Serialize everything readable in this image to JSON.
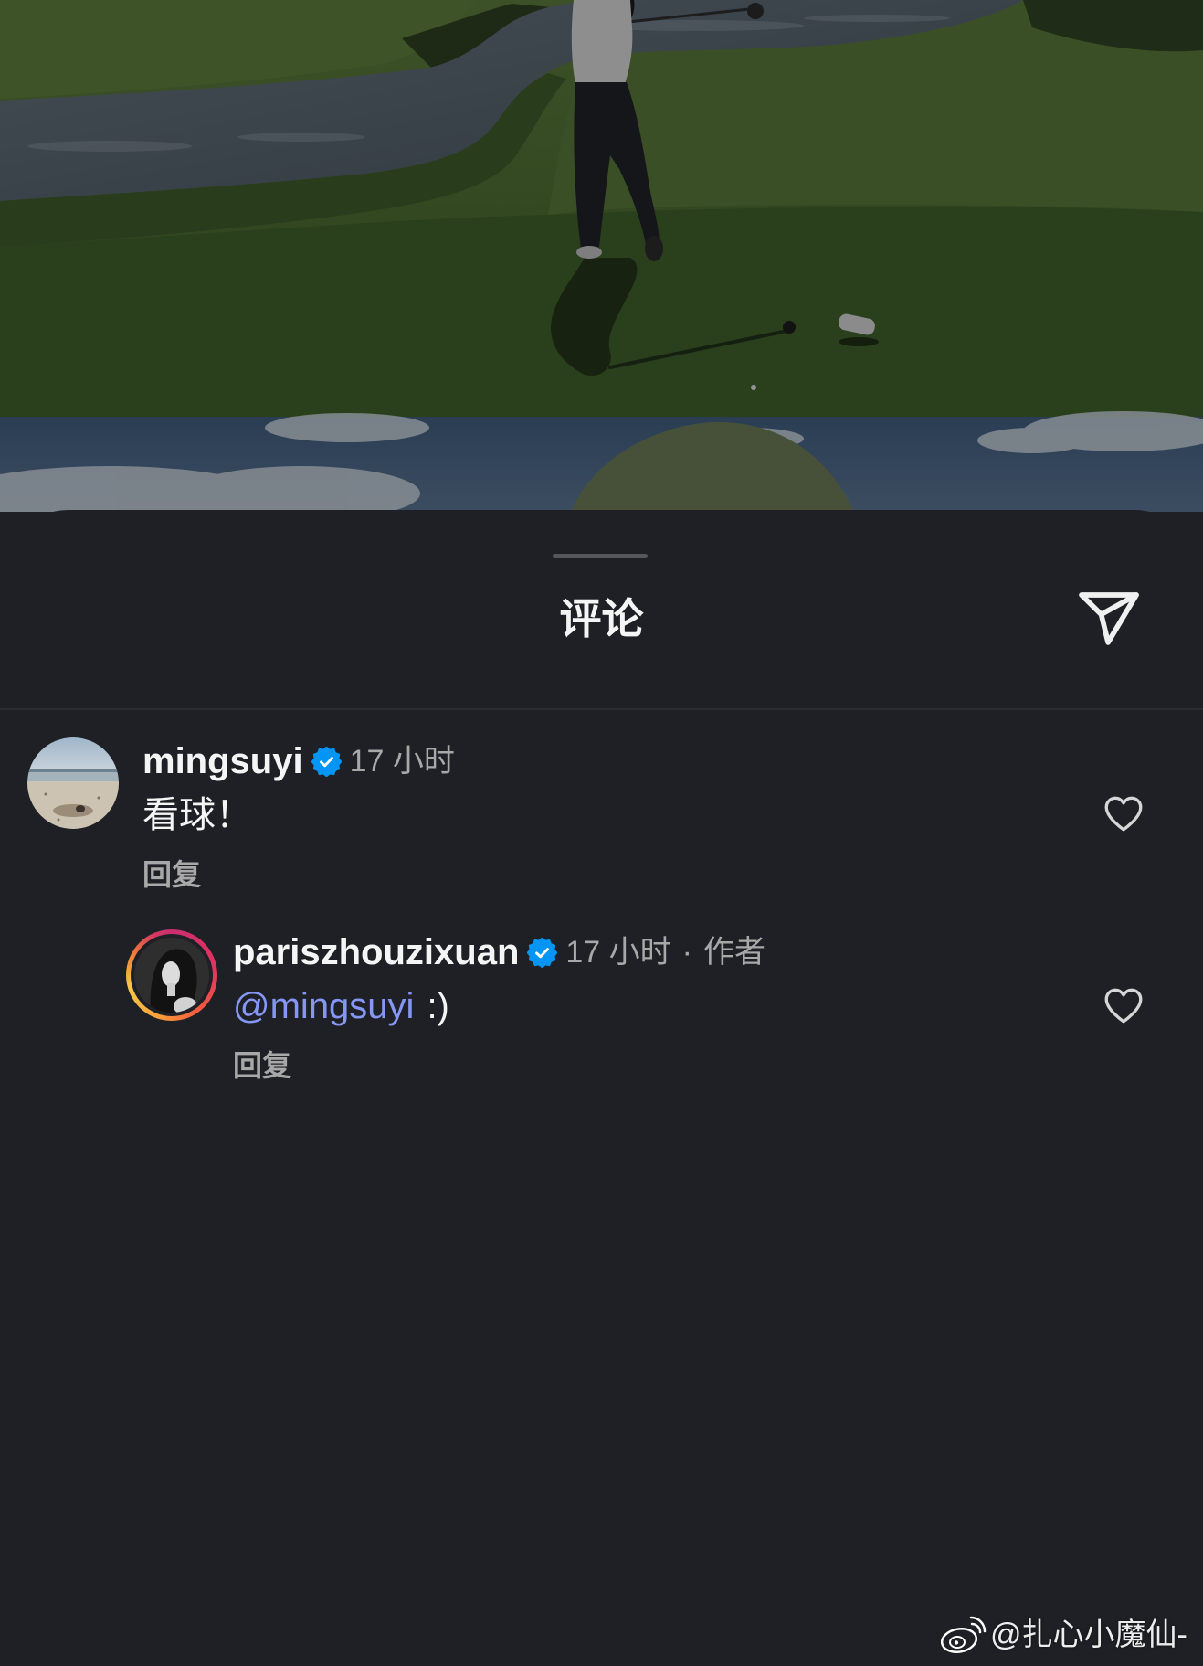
{
  "sheet": {
    "title": "评论"
  },
  "comments": [
    {
      "username": "mingsuyi",
      "verified": true,
      "time": "17 小时",
      "text": "看球！",
      "reply_label": "回复",
      "liked": false
    },
    {
      "username": "pariszhouzixuan",
      "verified": true,
      "time": "17 小时",
      "separator": "·",
      "author_label": "作者",
      "mention": "@mingsuyi",
      "text": ":)",
      "reply_label": "回复",
      "liked": false,
      "is_reply": true
    }
  ],
  "watermark": {
    "text": "@扎心小魔仙-",
    "icon": "weibo-logo-icon"
  },
  "icons": {
    "send": "send-icon",
    "like": "heart-outline-icon",
    "verified": "verified-badge-icon"
  },
  "colors": {
    "sheet_background": "#1f2025",
    "text_primary": "#f5f5f5",
    "text_secondary": "#a8a8a8",
    "mention": "#8596f5",
    "verified": "#0095f6"
  }
}
